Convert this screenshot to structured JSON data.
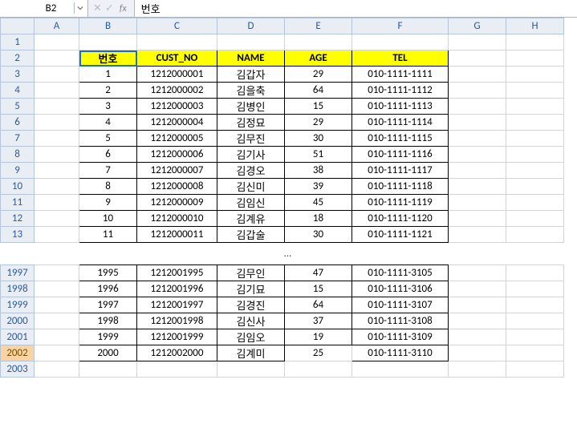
{
  "name_box": "B2",
  "formula": "번호",
  "columns": [
    "A",
    "B",
    "C",
    "D",
    "E",
    "F",
    "G",
    "H"
  ],
  "headers": [
    "번호",
    "CUST_NO",
    "NAME",
    "AGE",
    "TEL"
  ],
  "rows_top": [
    {
      "r": 1
    },
    {
      "r": 2,
      "header": true
    },
    {
      "r": 3,
      "d": [
        "1",
        "1212000001",
        "김갑자",
        "29",
        "010-1111-1111"
      ]
    },
    {
      "r": 4,
      "d": [
        "2",
        "1212000002",
        "김을축",
        "64",
        "010-1111-1112"
      ]
    },
    {
      "r": 5,
      "d": [
        "3",
        "1212000003",
        "김병인",
        "15",
        "010-1111-1113"
      ]
    },
    {
      "r": 6,
      "d": [
        "4",
        "1212000004",
        "김정묘",
        "29",
        "010-1111-1114"
      ]
    },
    {
      "r": 7,
      "d": [
        "5",
        "1212000005",
        "김무진",
        "30",
        "010-1111-1115"
      ]
    },
    {
      "r": 8,
      "d": [
        "6",
        "1212000006",
        "김기사",
        "51",
        "010-1111-1116"
      ]
    },
    {
      "r": 9,
      "d": [
        "7",
        "1212000007",
        "김경오",
        "38",
        "010-1111-1117"
      ]
    },
    {
      "r": 10,
      "d": [
        "8",
        "1212000008",
        "김신미",
        "39",
        "010-1111-1118"
      ]
    },
    {
      "r": 11,
      "d": [
        "9",
        "1212000009",
        "김임신",
        "45",
        "010-1111-1119"
      ]
    },
    {
      "r": 12,
      "d": [
        "10",
        "1212000010",
        "김계유",
        "18",
        "010-1111-1120"
      ]
    },
    {
      "r": 13,
      "d": [
        "11",
        "1212000011",
        "김갑술",
        "30",
        "010-1111-1121"
      ]
    }
  ],
  "ellipsis": "…",
  "rows_bottom": [
    {
      "r": 1997,
      "d": [
        "1995",
        "1212001995",
        "김무인",
        "47",
        "010-1111-3105"
      ]
    },
    {
      "r": 1998,
      "d": [
        "1996",
        "1212001996",
        "김기묘",
        "15",
        "010-1111-3106"
      ]
    },
    {
      "r": 1999,
      "d": [
        "1997",
        "1212001997",
        "김경진",
        "64",
        "010-1111-3107"
      ]
    },
    {
      "r": 2000,
      "d": [
        "1998",
        "1212001998",
        "김신사",
        "37",
        "010-1111-3108"
      ]
    },
    {
      "r": 2001,
      "d": [
        "1999",
        "1212001999",
        "김임오",
        "19",
        "010-1111-3109"
      ]
    },
    {
      "r": 2002,
      "d": [
        "2000",
        "1212002000",
        "김계미",
        "25",
        "010-1111-3110"
      ]
    },
    {
      "r": 2003
    }
  ],
  "active_row": 2002,
  "gap_col": "E",
  "chart_data": {
    "type": "table",
    "columns": [
      "번호",
      "CUST_NO",
      "NAME",
      "AGE",
      "TEL"
    ],
    "visible_rows_top": [
      [
        1,
        "1212000001",
        "김갑자",
        29,
        "010-1111-1111"
      ],
      [
        2,
        "1212000002",
        "김을축",
        64,
        "010-1111-1112"
      ],
      [
        3,
        "1212000003",
        "김병인",
        15,
        "010-1111-1113"
      ],
      [
        4,
        "1212000004",
        "김정묘",
        29,
        "010-1111-1114"
      ],
      [
        5,
        "1212000005",
        "김무진",
        30,
        "010-1111-1115"
      ],
      [
        6,
        "1212000006",
        "김기사",
        51,
        "010-1111-1116"
      ],
      [
        7,
        "1212000007",
        "김경오",
        38,
        "010-1111-1117"
      ],
      [
        8,
        "1212000008",
        "김신미",
        39,
        "010-1111-1118"
      ],
      [
        9,
        "1212000009",
        "김임신",
        45,
        "010-1111-1119"
      ],
      [
        10,
        "1212000010",
        "김계유",
        18,
        "010-1111-1120"
      ],
      [
        11,
        "1212000011",
        "김갑술",
        30,
        "010-1111-1121"
      ]
    ],
    "visible_rows_bottom": [
      [
        1995,
        "1212001995",
        "김무인",
        47,
        "010-1111-3105"
      ],
      [
        1996,
        "1212001996",
        "김기묘",
        15,
        "010-1111-3106"
      ],
      [
        1997,
        "1212001997",
        "김경진",
        64,
        "010-1111-3107"
      ],
      [
        1998,
        "1212001998",
        "김신사",
        37,
        "010-1111-3108"
      ],
      [
        1999,
        "1212001999",
        "김임오",
        19,
        "010-1111-3109"
      ],
      [
        2000,
        "1212002000",
        "김계미",
        25,
        "010-1111-3110"
      ]
    ]
  }
}
